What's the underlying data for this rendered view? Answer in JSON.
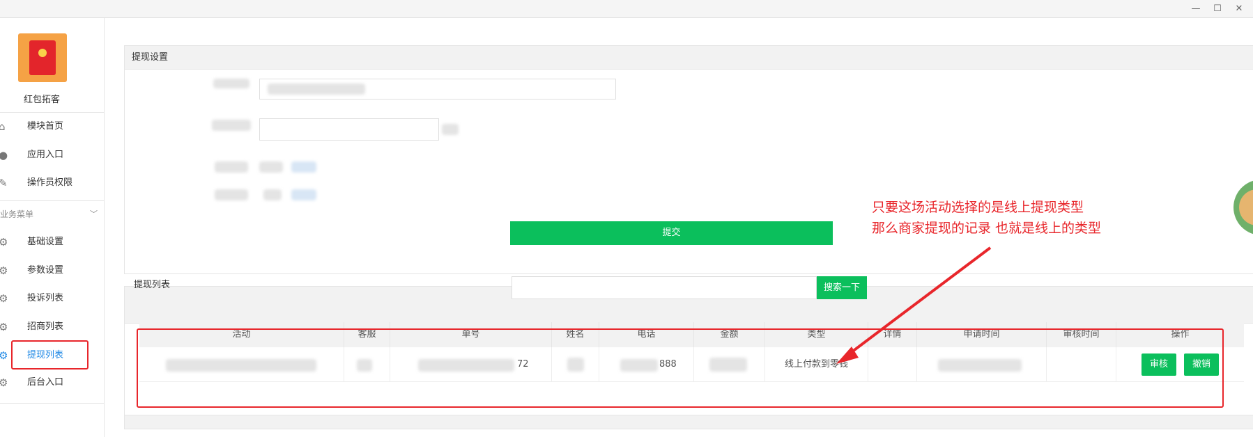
{
  "window": {
    "minimize": "—",
    "maximize": "☐",
    "close": "✕"
  },
  "sidebar": {
    "app_name": "红包拓客",
    "items": [
      {
        "label": "模块首页",
        "icon": "home-icon",
        "glyph": "⌂"
      },
      {
        "label": "应用入口",
        "icon": "chat-bubble-icon",
        "glyph": "●"
      },
      {
        "label": "操作员权限",
        "icon": "document-edit-icon",
        "glyph": "✎"
      }
    ],
    "section": {
      "label": "业务菜单",
      "chevron": "﹀"
    },
    "business_items": [
      {
        "label": "基础设置",
        "icon": "gear-icon",
        "glyph": "⚙"
      },
      {
        "label": "参数设置",
        "icon": "gear-icon",
        "glyph": "⚙"
      },
      {
        "label": "投诉列表",
        "icon": "gear-icon",
        "glyph": "⚙"
      },
      {
        "label": "招商列表",
        "icon": "gear-icon",
        "glyph": "⚙"
      },
      {
        "label": "提现列表",
        "icon": "gear-icon",
        "glyph": "⚙",
        "active": true
      },
      {
        "label": "后台入口",
        "icon": "gear-icon",
        "glyph": "⚙"
      }
    ]
  },
  "settings_panel": {
    "title": "提现设置",
    "submit_label": "提交"
  },
  "list_panel": {
    "title": "提现列表",
    "search_label": "搜索一下",
    "columns": [
      "活动",
      "客服",
      "单号",
      "姓名",
      "电话",
      "金额",
      "类型",
      "详情",
      "申请时间",
      "审核时间",
      "操作"
    ],
    "row": {
      "order_suffix": "72",
      "phone_suffix": "888",
      "type": "线上付款到零钱",
      "approve_label": "审核",
      "revoke_label": "撤销"
    }
  },
  "annotation": {
    "line1": "只要这场活动选择的是线上提现类型",
    "line2": "那么商家提现的记录 也就是线上的类型"
  },
  "colors": {
    "accent_green": "#0bbf5c",
    "annotation_red": "#e8262b",
    "active_blue": "#1e88e5"
  }
}
